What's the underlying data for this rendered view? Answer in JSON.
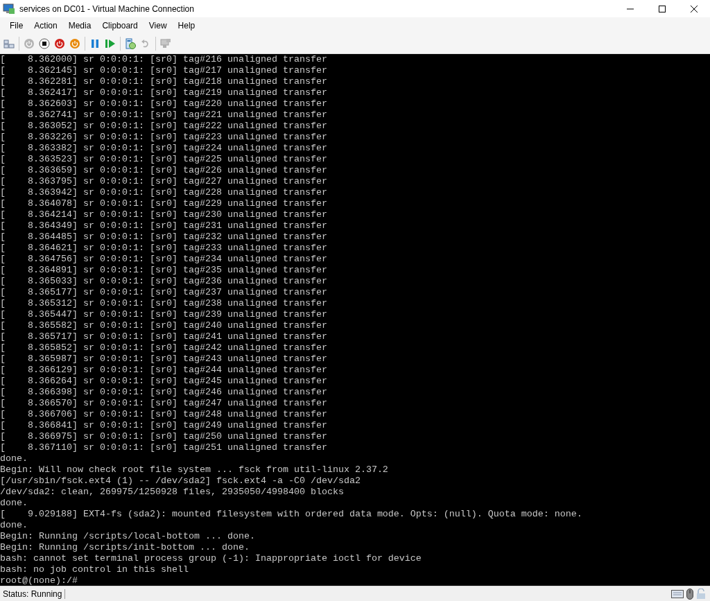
{
  "window": {
    "title": "services on DC01 - Virtual Machine Connection"
  },
  "menu": [
    "File",
    "Action",
    "Media",
    "Clipboard",
    "View",
    "Help"
  ],
  "console": {
    "lines": [
      "[    8.362000] sr 0:0:0:1: [sr0] tag#216 unaligned transfer",
      "[    8.362145] sr 0:0:0:1: [sr0] tag#217 unaligned transfer",
      "[    8.362281] sr 0:0:0:1: [sr0] tag#218 unaligned transfer",
      "[    8.362417] sr 0:0:0:1: [sr0] tag#219 unaligned transfer",
      "[    8.362603] sr 0:0:0:1: [sr0] tag#220 unaligned transfer",
      "[    8.362741] sr 0:0:0:1: [sr0] tag#221 unaligned transfer",
      "[    8.363052] sr 0:0:0:1: [sr0] tag#222 unaligned transfer",
      "[    8.363226] sr 0:0:0:1: [sr0] tag#223 unaligned transfer",
      "[    8.363382] sr 0:0:0:1: [sr0] tag#224 unaligned transfer",
      "[    8.363523] sr 0:0:0:1: [sr0] tag#225 unaligned transfer",
      "[    8.363659] sr 0:0:0:1: [sr0] tag#226 unaligned transfer",
      "[    8.363795] sr 0:0:0:1: [sr0] tag#227 unaligned transfer",
      "[    8.363942] sr 0:0:0:1: [sr0] tag#228 unaligned transfer",
      "[    8.364078] sr 0:0:0:1: [sr0] tag#229 unaligned transfer",
      "[    8.364214] sr 0:0:0:1: [sr0] tag#230 unaligned transfer",
      "[    8.364349] sr 0:0:0:1: [sr0] tag#231 unaligned transfer",
      "[    8.364485] sr 0:0:0:1: [sr0] tag#232 unaligned transfer",
      "[    8.364621] sr 0:0:0:1: [sr0] tag#233 unaligned transfer",
      "[    8.364756] sr 0:0:0:1: [sr0] tag#234 unaligned transfer",
      "[    8.364891] sr 0:0:0:1: [sr0] tag#235 unaligned transfer",
      "[    8.365033] sr 0:0:0:1: [sr0] tag#236 unaligned transfer",
      "[    8.365177] sr 0:0:0:1: [sr0] tag#237 unaligned transfer",
      "[    8.365312] sr 0:0:0:1: [sr0] tag#238 unaligned transfer",
      "[    8.365447] sr 0:0:0:1: [sr0] tag#239 unaligned transfer",
      "[    8.365582] sr 0:0:0:1: [sr0] tag#240 unaligned transfer",
      "[    8.365717] sr 0:0:0:1: [sr0] tag#241 unaligned transfer",
      "[    8.365852] sr 0:0:0:1: [sr0] tag#242 unaligned transfer",
      "[    8.365987] sr 0:0:0:1: [sr0] tag#243 unaligned transfer",
      "[    8.366129] sr 0:0:0:1: [sr0] tag#244 unaligned transfer",
      "[    8.366264] sr 0:0:0:1: [sr0] tag#245 unaligned transfer",
      "[    8.366398] sr 0:0:0:1: [sr0] tag#246 unaligned transfer",
      "[    8.366570] sr 0:0:0:1: [sr0] tag#247 unaligned transfer",
      "[    8.366706] sr 0:0:0:1: [sr0] tag#248 unaligned transfer",
      "[    8.366841] sr 0:0:0:1: [sr0] tag#249 unaligned transfer",
      "[    8.366975] sr 0:0:0:1: [sr0] tag#250 unaligned transfer",
      "[    8.367110] sr 0:0:0:1: [sr0] tag#251 unaligned transfer",
      "done.",
      "Begin: Will now check root file system ... fsck from util-linux 2.37.2",
      "[/usr/sbin/fsck.ext4 (1) -- /dev/sda2] fsck.ext4 -a -C0 /dev/sda2",
      "/dev/sda2: clean, 269975/1250928 files, 2935050/4998400 blocks",
      "done.",
      "[    9.029188] EXT4-fs (sda2): mounted filesystem with ordered data mode. Opts: (null). Quota mode: none.",
      "done.",
      "Begin: Running /scripts/local-bottom ... done.",
      "Begin: Running /scripts/init-bottom ... done.",
      "bash: cannot set terminal process group (-1): Inappropriate ioctl for device",
      "bash: no job control in this shell",
      "root@(none):/#"
    ]
  },
  "status_bar": {
    "text": "Status: Running"
  }
}
